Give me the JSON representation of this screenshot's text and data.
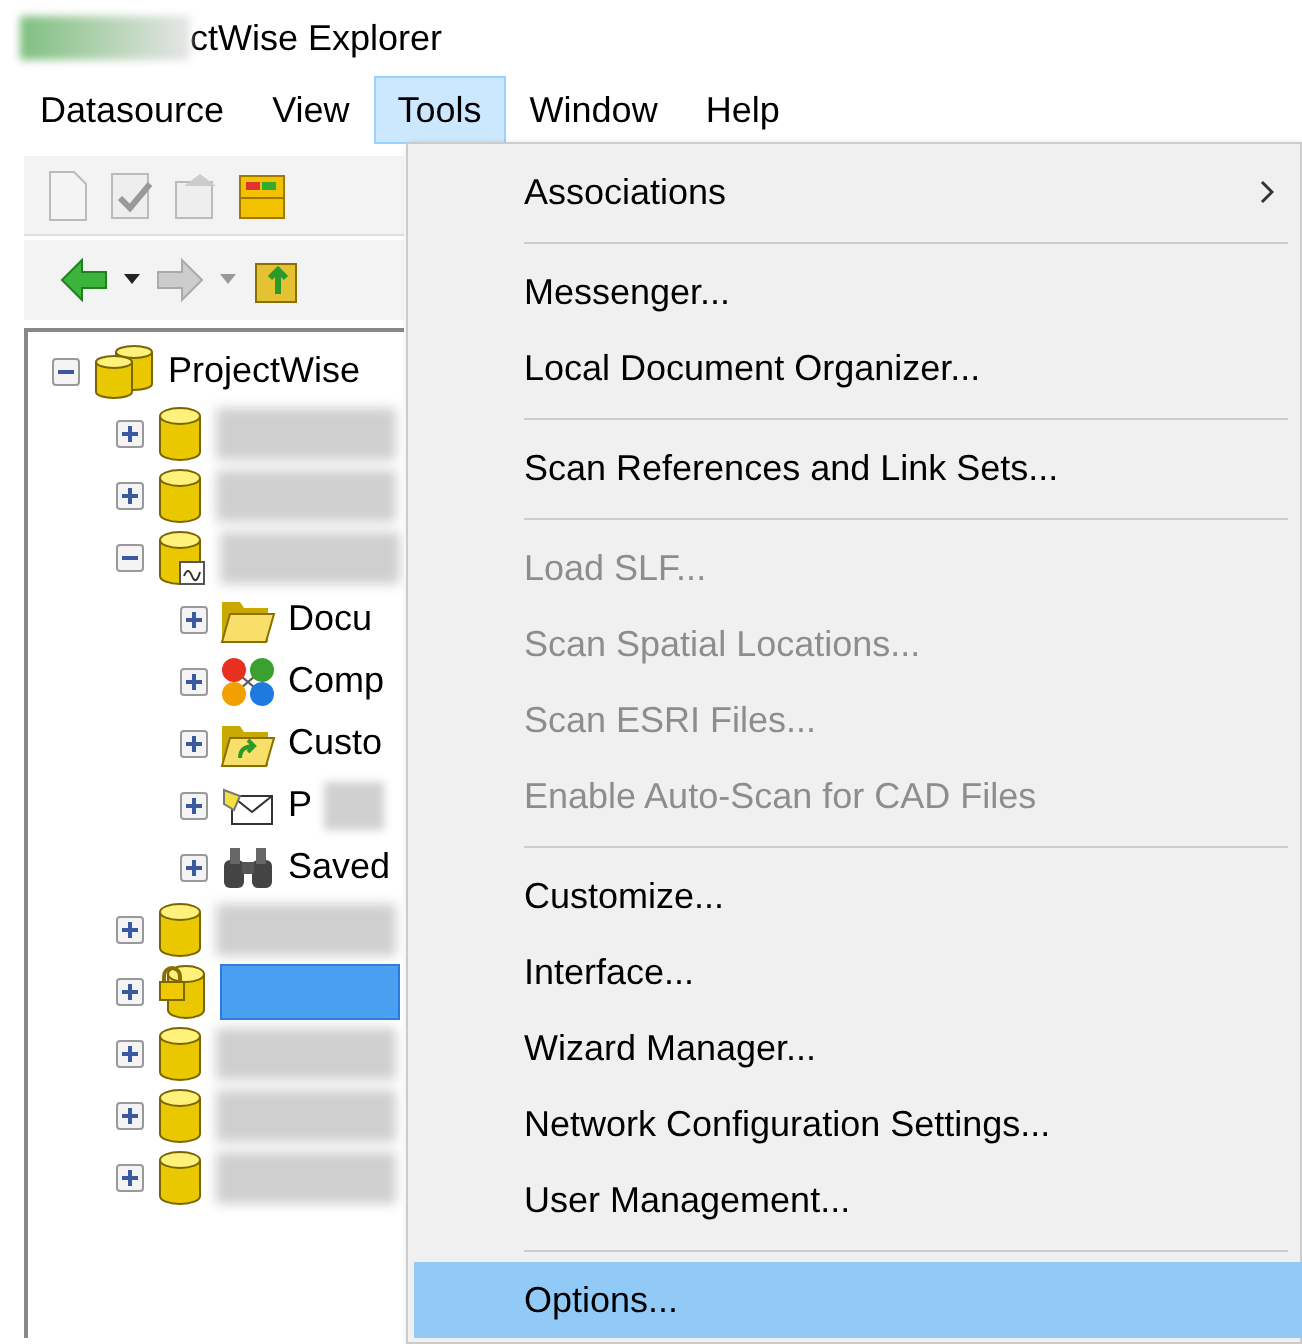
{
  "window": {
    "title": "ctWise Explorer"
  },
  "menubar": [
    {
      "label": "Datasource",
      "selected": false
    },
    {
      "label": "View",
      "selected": false
    },
    {
      "label": "Tools",
      "selected": true
    },
    {
      "label": "Window",
      "selected": false
    },
    {
      "label": "Help",
      "selected": false
    }
  ],
  "tree": {
    "label": "ProjectWise",
    "kind": "databases",
    "expanded": true,
    "children": [
      {
        "kind": "database",
        "redacted": true,
        "expanded": false
      },
      {
        "kind": "database",
        "redacted": true,
        "expanded": false
      },
      {
        "kind": "database-linked",
        "redacted": true,
        "expanded": true,
        "children": [
          {
            "label": "Docu",
            "kind": "folder",
            "expanded": false
          },
          {
            "label": "Comp",
            "kind": "components",
            "expanded": false
          },
          {
            "label": "Custo",
            "kind": "custom-folder",
            "expanded": false
          },
          {
            "label": "P",
            "kind": "envelope",
            "redacted": true,
            "expanded": false
          },
          {
            "label": "Saved",
            "kind": "binoculars",
            "expanded": false
          }
        ]
      },
      {
        "kind": "database",
        "redacted": true,
        "expanded": false
      },
      {
        "kind": "database-locked",
        "redacted": true,
        "selected": true,
        "expanded": false
      },
      {
        "kind": "database",
        "redacted": true,
        "expanded": false
      },
      {
        "kind": "database",
        "redacted": true,
        "expanded": false
      },
      {
        "kind": "database",
        "redacted": true,
        "expanded": false
      }
    ]
  },
  "tools_menu": [
    {
      "kind": "item",
      "label": "Associations",
      "submenu": true,
      "disabled": false,
      "selected": false
    },
    {
      "kind": "separator"
    },
    {
      "kind": "item",
      "label": "Messenger...",
      "disabled": false,
      "selected": false
    },
    {
      "kind": "item",
      "label": "Local Document Organizer...",
      "disabled": false,
      "selected": false
    },
    {
      "kind": "separator"
    },
    {
      "kind": "item",
      "label": "Scan References and Link Sets...",
      "disabled": false,
      "selected": false
    },
    {
      "kind": "separator"
    },
    {
      "kind": "item",
      "label": "Load SLF...",
      "disabled": true,
      "selected": false
    },
    {
      "kind": "item",
      "label": "Scan Spatial Locations...",
      "disabled": true,
      "selected": false
    },
    {
      "kind": "item",
      "label": "Scan ESRI Files...",
      "disabled": true,
      "selected": false
    },
    {
      "kind": "item",
      "label": "Enable Auto-Scan for CAD Files",
      "disabled": true,
      "selected": false
    },
    {
      "kind": "separator"
    },
    {
      "kind": "item",
      "label": "Customize...",
      "disabled": false,
      "selected": false
    },
    {
      "kind": "item",
      "label": "Interface...",
      "disabled": false,
      "selected": false
    },
    {
      "kind": "item",
      "label": "Wizard Manager...",
      "disabled": false,
      "selected": false
    },
    {
      "kind": "item",
      "label": "Network Configuration Settings...",
      "disabled": false,
      "selected": false
    },
    {
      "kind": "item",
      "label": "User Management...",
      "disabled": false,
      "selected": false
    },
    {
      "kind": "separator"
    },
    {
      "kind": "item",
      "label": "Options...",
      "disabled": false,
      "selected": true
    }
  ]
}
